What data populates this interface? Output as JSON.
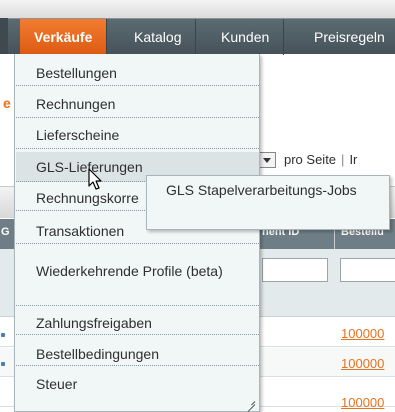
{
  "navbar": {
    "items": [
      {
        "label": "Verkäufe",
        "active": true
      },
      {
        "label": "Katalog",
        "active": false
      },
      {
        "label": "Kunden",
        "active": false
      },
      {
        "label": "Preisregeln",
        "active": false
      }
    ]
  },
  "background": {
    "pager_suffix": "pro Seite",
    "pager_sep": "|",
    "pager_next": "Ir",
    "columns": [
      {
        "label": "G"
      },
      {
        "label": "nent ID"
      },
      {
        "label": "Bestellu"
      }
    ],
    "order_links": [
      "100000",
      "100000",
      "100000"
    ]
  },
  "menu": {
    "items": [
      {
        "label": "Bestellungen"
      },
      {
        "label": "Rechnungen"
      },
      {
        "label": "Lieferscheine"
      },
      {
        "label": "GLS-Lieferungen"
      },
      {
        "label": "Rechnungskorre"
      },
      {
        "label": "Transaktionen"
      },
      {
        "label": "Wiederkehrende Profile (beta)"
      },
      {
        "label": "Zahlungsfreigaben"
      },
      {
        "label": "Bestellbedingungen"
      },
      {
        "label": "Steuer"
      }
    ],
    "hovered": "GLS-Lieferungen"
  },
  "submenu": {
    "item": "GLS Stapelverarbeitungs-Jobs"
  },
  "colors": {
    "nav_active": "#e8691f",
    "nav_bg": "#4e5b62",
    "menu_bg": "#f1f6f7",
    "link": "#e8721d"
  }
}
